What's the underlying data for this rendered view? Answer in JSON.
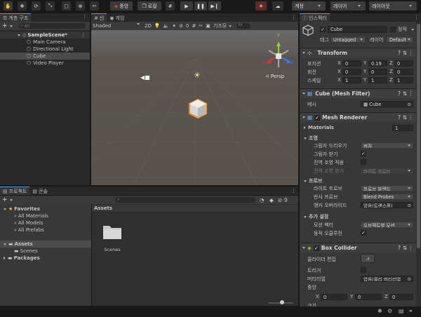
{
  "toolbar": {
    "pivot_label": "중앙",
    "local_label": "로컬",
    "account_label": "계정",
    "layers_label": "레이어",
    "layout_label": "레이아웃"
  },
  "hierarchy": {
    "tab_label": "계층 구조",
    "search_placeholder": "All",
    "scene_name": "SampleScene*",
    "items": [
      "Main Camera",
      "Directional Light",
      "Cube",
      "Video Player"
    ]
  },
  "scene_view": {
    "scene_tab": "씬",
    "game_tab": "게임",
    "shading_mode": "Shaded",
    "mode_2d": "2D",
    "hidden_count": "0",
    "gizmos_label": "기즈모",
    "search_placeholder": "All",
    "persp_label": "Persp",
    "axis_x": "x",
    "axis_y": "y",
    "axis_z": "z"
  },
  "project": {
    "project_tab": "프로젝트",
    "console_tab": "콘솔",
    "badge_count": "9",
    "favorites_label": "Favorites",
    "favorites": [
      "All Materials",
      "All Models",
      "All Prefabs"
    ],
    "assets_label": "Assets",
    "scenes_label": "Scenes",
    "packages_label": "Packages",
    "breadcrumb": "Assets",
    "folder_name": "Scenes"
  },
  "inspector": {
    "tab_label": "인스펙터",
    "object_name": "Cube",
    "static_label": "정적",
    "tag_label": "태그",
    "tag_value": "Untagged",
    "layer_label": "레이어",
    "layer_value": "Default",
    "transform": {
      "title": "Transform",
      "position_label": "포지션",
      "rotation_label": "회전",
      "scale_label": "스케일",
      "position": [
        "0",
        "0.19",
        "0"
      ],
      "rotation": [
        "0",
        "0",
        "0"
      ],
      "scale": [
        "1",
        "1",
        "1"
      ]
    },
    "mesh_filter": {
      "title": "Cube (Mesh Filter)",
      "mesh_label": "메시",
      "mesh_value": "Cube"
    },
    "mesh_renderer": {
      "title": "Mesh Renderer",
      "materials_label": "Materials",
      "materials_count": "1",
      "lighting_label": "조명",
      "cast_shadows_label": "그림자 드리우기",
      "cast_shadows_value": "켜짐",
      "receive_shadows_label": "그림자 받기",
      "contribute_gi_label": "전역 조명 적용",
      "receive_gi_label": "전역 조명 받기",
      "receive_gi_value": "라이트 프로브",
      "probes_label": "프로브",
      "light_probes_label": "라이트 프로브",
      "light_probes_value": "프로브 블렌드",
      "reflection_probes_label": "반사 프로브",
      "reflection_probes_value": "Blend Probes",
      "anchor_override_label": "앵커 오버라이드",
      "anchor_override_value": "없음(트랜스폼)",
      "additional_label": "추가 설정",
      "motion_vectors_label": "모션 벡터",
      "motion_vectors_value": "오브젝트별 모션",
      "dynamic_occlusion_label": "동적 오클루전"
    },
    "box_collider": {
      "title": "Box Collider",
      "edit_collider_label": "콜라이더 편집",
      "trigger_label": "트리거",
      "material_label": "머티리얼",
      "material_value": "없음(물리 머티리얼",
      "center_label": "중앙",
      "center": [
        "0",
        "0",
        "0"
      ],
      "size_label": "크기"
    }
  },
  "colors": {
    "accent": "#46a0f5",
    "cube_outline": "#f08a1d",
    "x_axis": "#d8333a",
    "y_axis": "#8dd136",
    "z_axis": "#3a79e0"
  }
}
